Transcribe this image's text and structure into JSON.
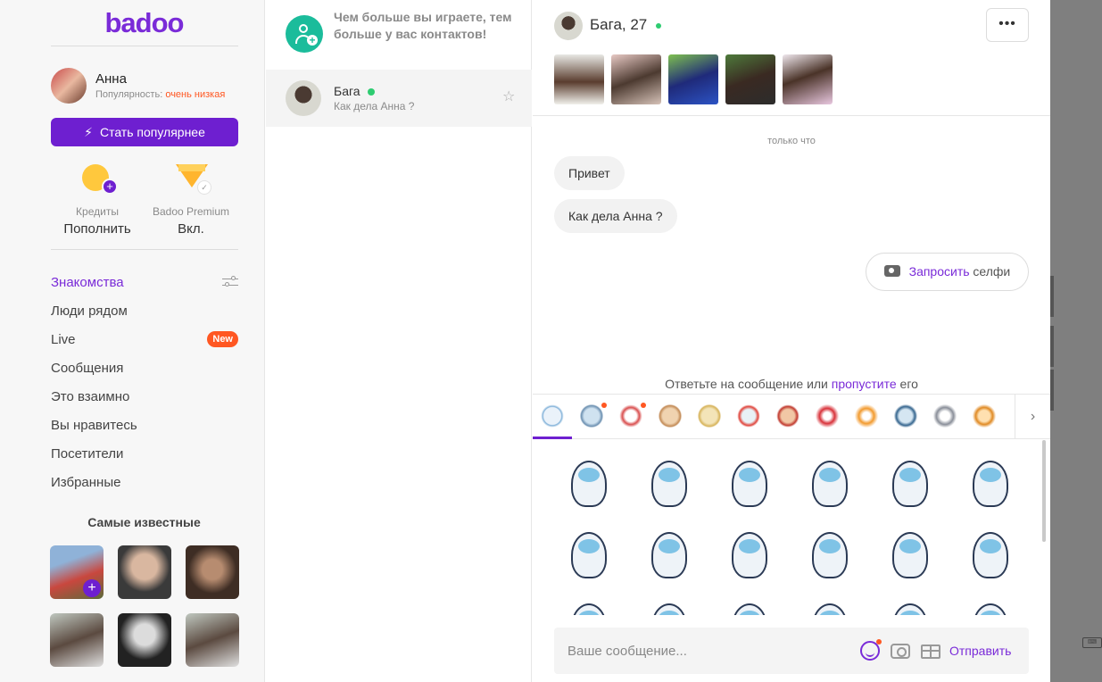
{
  "app": {
    "logo": "badoo"
  },
  "profile": {
    "name": "Анна",
    "popularity_label": "Популярность:",
    "popularity_value": "очень низкая",
    "cta": "Стать популярнее"
  },
  "wallet": {
    "credits": {
      "label": "Кредиты",
      "action": "Пополнить",
      "icon": "coin-icon"
    },
    "premium": {
      "label": "Badoo Premium",
      "status": "Вкл.",
      "icon": "diamond-icon"
    }
  },
  "nav": [
    {
      "label": "Знакомства",
      "active": true
    },
    {
      "label": "Люди рядом"
    },
    {
      "label": "Live",
      "badge": "New"
    },
    {
      "label": "Сообщения"
    },
    {
      "label": "Это взаимно"
    },
    {
      "label": "Вы нравитесь"
    },
    {
      "label": "Посетители"
    },
    {
      "label": "Избранные"
    }
  ],
  "famous": {
    "title": "Самые известные",
    "add_symbol": "+"
  },
  "contacts": {
    "promo": "Чем больше вы играете, тем больше у вас контактов!",
    "items": [
      {
        "name": "Бага",
        "last_message": "Как дела Анна ?",
        "online": true
      }
    ]
  },
  "chat": {
    "name": "Бага, 27",
    "more": "•••",
    "timestamp": "только что",
    "messages": [
      "Привет",
      "Как дела Анна ?"
    ],
    "selfie_action": "Запросить",
    "selfie_object": "селфи",
    "reply_prefix": "Ответьте на сообщение или",
    "reply_link": "пропустите",
    "reply_suffix": "его",
    "input_placeholder": "Ваше сообщение...",
    "send": "Отправить",
    "tabs_next": "›"
  },
  "colors": {
    "brand": "#6e1fd0",
    "accent": "#7a2bd8",
    "alert": "#ff5722",
    "online": "#2ecc71",
    "promo": "#1bbc9b"
  }
}
